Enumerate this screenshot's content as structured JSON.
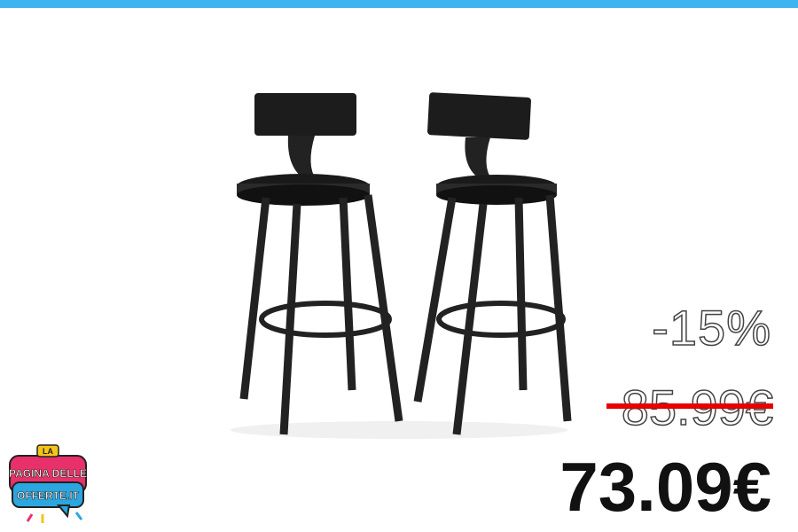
{
  "product": {
    "image_icon": "bar-stools-pair-image"
  },
  "pricing": {
    "discount": "-15%",
    "old_price": "85.99€",
    "price": "73.09€"
  },
  "logo": {
    "line1": "LA",
    "line2": "PAGINA DELLE",
    "line3": "OFFERTE.IT"
  },
  "colors": {
    "top_bar": "#3db4f2",
    "strike": "#e60000",
    "logo_pink": "#e8306a",
    "logo_blue": "#2aa6e0",
    "logo_yellow": "#f5c518"
  }
}
